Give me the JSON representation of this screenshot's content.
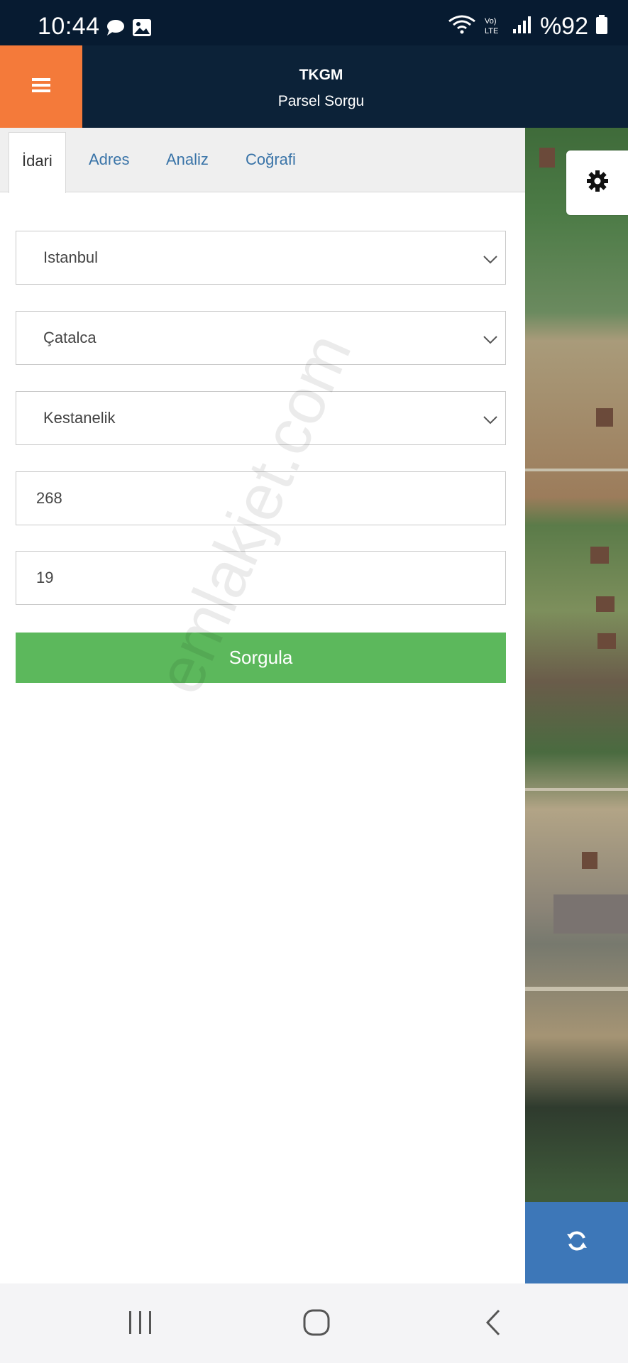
{
  "status_bar": {
    "time": "10:44",
    "battery": "%92",
    "left_icons": [
      "chat-bubble-icon",
      "image-icon"
    ],
    "right_icons": [
      "wifi-icon",
      "volte-icon",
      "signal-icon",
      "battery-icon"
    ]
  },
  "header": {
    "title": "TKGM",
    "subtitle": "Parsel Sorgu",
    "menu_icon": "hamburger-menu-icon"
  },
  "tabs": [
    {
      "label": "İdari",
      "active": true
    },
    {
      "label": "Adres",
      "active": false
    },
    {
      "label": "Analiz",
      "active": false
    },
    {
      "label": "Coğrafi",
      "active": false
    }
  ],
  "form": {
    "province": "Istanbul",
    "district": "Çatalca",
    "neighborhood": "Kestanelik",
    "block": "268",
    "parcel": "19",
    "submit_label": "Sorgula"
  },
  "watermark": "emlakjet.com",
  "map": {
    "settings_icon": "gear-icon",
    "refresh_icon": "refresh-icon"
  },
  "colors": {
    "header_bg": "#0c2238",
    "menu_bg": "#f47a3a",
    "submit_bg": "#5cb85c",
    "refresh_bg": "#3d77b8",
    "tab_link": "#3a74a8"
  },
  "nav": [
    "recent-apps-icon",
    "home-icon",
    "back-icon"
  ]
}
